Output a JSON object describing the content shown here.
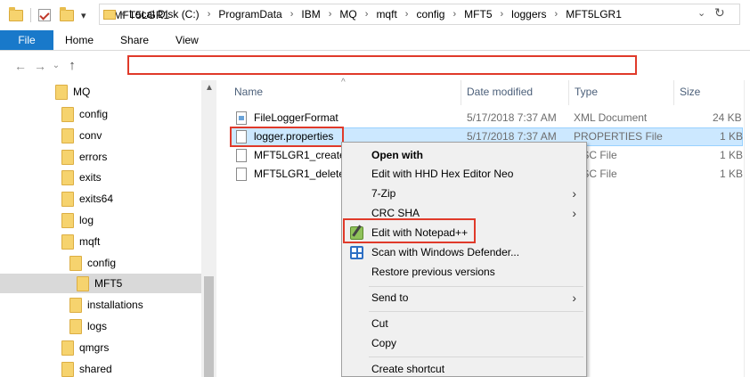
{
  "window": {
    "title": "MFT5LGR1"
  },
  "ribbon": {
    "tabs": [
      "File",
      "Home",
      "Share",
      "View"
    ]
  },
  "address": {
    "crumbs": [
      "Local Disk (C:)",
      "ProgramData",
      "IBM",
      "MQ",
      "mqft",
      "config",
      "MFT5",
      "loggers",
      "MFT5LGR1"
    ],
    "prefix": "«",
    "separator": "›"
  },
  "nav": {
    "items": [
      {
        "label": "MQ",
        "indent": 0
      },
      {
        "label": "config",
        "indent": 1
      },
      {
        "label": "conv",
        "indent": 1
      },
      {
        "label": "errors",
        "indent": 1
      },
      {
        "label": "exits",
        "indent": 1
      },
      {
        "label": "exits64",
        "indent": 1
      },
      {
        "label": "log",
        "indent": 1
      },
      {
        "label": "mqft",
        "indent": 1
      },
      {
        "label": "config",
        "indent": 2
      },
      {
        "label": "MFT5",
        "indent": 3,
        "selected": true
      },
      {
        "label": "installations",
        "indent": 2
      },
      {
        "label": "logs",
        "indent": 2
      },
      {
        "label": "qmgrs",
        "indent": 1
      },
      {
        "label": "shared",
        "indent": 1
      }
    ]
  },
  "files": {
    "columns": [
      "Name",
      "Date modified",
      "Type",
      "Size"
    ],
    "rows": [
      {
        "name": "FileLoggerFormat",
        "date": "5/17/2018 7:37 AM",
        "type": "XML Document",
        "size": "24 KB"
      },
      {
        "name": "logger.properties",
        "date": "5/17/2018 7:37 AM",
        "type": "PROPERTIES File",
        "size": "1 KB",
        "selected": true
      },
      {
        "name": "MFT5LGR1_create.",
        "date": "",
        "type": "QSC File",
        "size": "1 KB"
      },
      {
        "name": "MFT5LGR1_delete.",
        "date": "",
        "type": "QSC File",
        "size": "1 KB"
      }
    ]
  },
  "context_menu": {
    "items": [
      {
        "label": "Open with",
        "bold": true
      },
      {
        "label": "Edit with HHD Hex Editor Neo"
      },
      {
        "label": "7-Zip",
        "submenu": true
      },
      {
        "label": "CRC SHA",
        "submenu": true
      },
      {
        "label": "Edit with Notepad++",
        "icon": "notepad-plus-plus-icon"
      },
      {
        "label": "Scan with Windows Defender...",
        "icon": "windows-defender-icon"
      },
      {
        "label": "Restore previous versions"
      },
      {
        "label": "Send to",
        "submenu": true
      },
      {
        "label": "Cut"
      },
      {
        "label": "Copy"
      },
      {
        "label": "Create shortcut"
      }
    ]
  },
  "colors": {
    "accent": "#1979ca",
    "highlight": "#e03a2a",
    "selection": "#cce8ff",
    "folder": "#f6d36e"
  }
}
